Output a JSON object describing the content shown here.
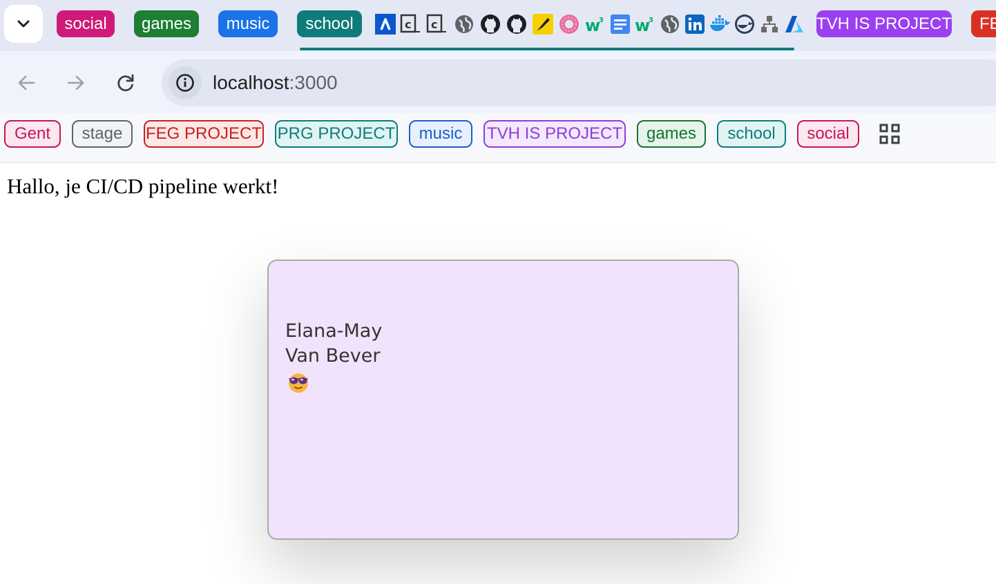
{
  "tabstrip": {
    "tab_groups": [
      {
        "label": "social",
        "color": "#d01a77"
      },
      {
        "label": "games",
        "color": "#1e7e34"
      },
      {
        "label": "music",
        "color": "#1a73e8"
      },
      {
        "label": "school",
        "color": "#0f7c7a"
      },
      {
        "label": "TVH IS PROJECT",
        "color": "#9b3ff0"
      },
      {
        "label": "FE",
        "color": "#d93025"
      }
    ],
    "favicons": [
      "atlassian-icon",
      "canvas-icon",
      "canvas-icon",
      "globe-icon",
      "github-icon",
      "github-icon",
      "pencil-app-icon",
      "donut-icon",
      "w3schools-icon",
      "google-docs-icon",
      "w3schools-icon",
      "globe-icon",
      "linkedin-icon",
      "docker-icon",
      "docker-hub-icon",
      "diagram-icon",
      "azure-icon"
    ]
  },
  "toolbar": {
    "url_host": "localhost",
    "url_port": ":3000"
  },
  "bookmarks": {
    "items": [
      {
        "label": "Gent",
        "color": "#c2185b",
        "bg": "#fde7ef"
      },
      {
        "label": "stage",
        "color": "#5f6368",
        "bg": "#f1f3f4"
      },
      {
        "label": "FEG PROJECT",
        "color": "#c5221f",
        "bg": "#fce8e6"
      },
      {
        "label": "PRG PROJECT",
        "color": "#0f7c7a",
        "bg": "#e0f4f3"
      },
      {
        "label": "music",
        "color": "#1a5fc7",
        "bg": "#e8f0fe"
      },
      {
        "label": "TVH IS PROJECT",
        "color": "#8e3fd6",
        "bg": "#f3e8fd"
      },
      {
        "label": "games",
        "color": "#137333",
        "bg": "#e6f4ea"
      },
      {
        "label": "school",
        "color": "#0f7c7a",
        "bg": "#e0f4f3"
      },
      {
        "label": "social",
        "color": "#c2185b",
        "bg": "#fde7ef"
      }
    ]
  },
  "page": {
    "heading": "Hallo, je CI/CD pipeline werkt!",
    "card": {
      "first_name": "Elana-May",
      "last_name": "Van Bever",
      "emoji": "😎"
    }
  }
}
